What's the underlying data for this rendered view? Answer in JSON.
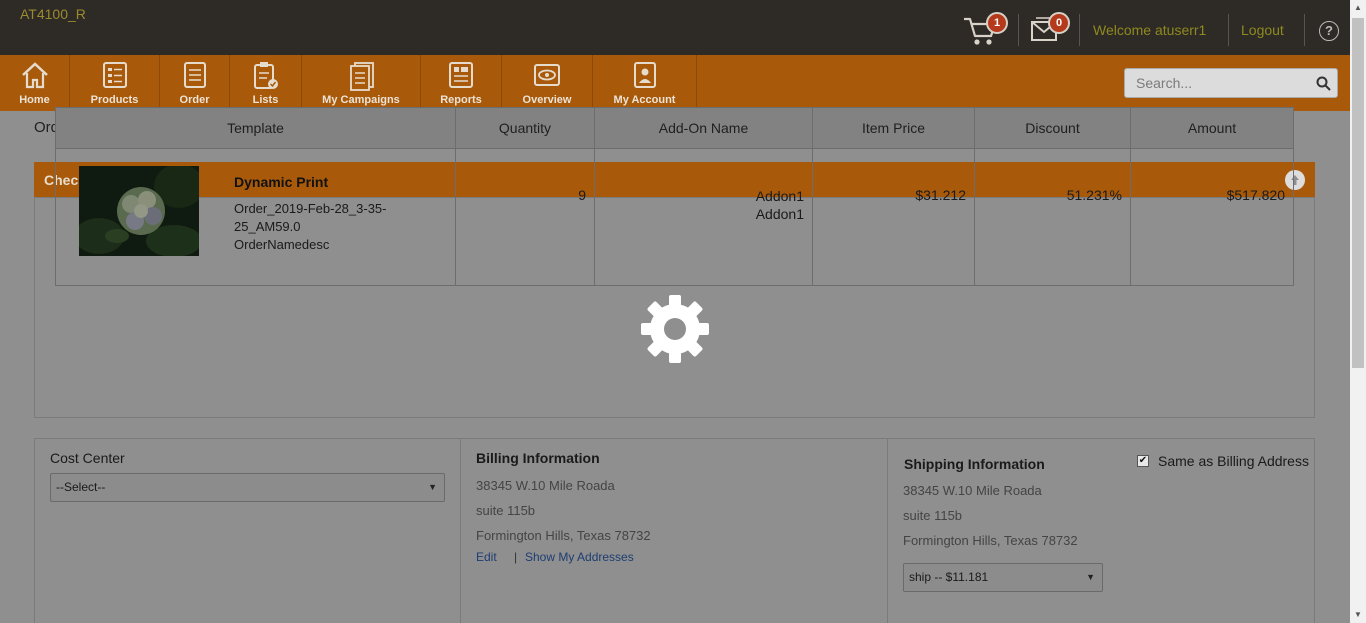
{
  "app": {
    "brand": "AT4100_R",
    "cart_count": "1",
    "messages_count": "0",
    "welcome": "Welcome atuserr1",
    "logout": "Logout",
    "help_icon": "?"
  },
  "nav": {
    "items": [
      {
        "label": "Home",
        "icon": "home-icon"
      },
      {
        "label": "Products",
        "icon": "products-icon"
      },
      {
        "label": "Order",
        "icon": "order-icon"
      },
      {
        "label": "Lists",
        "icon": "lists-icon"
      },
      {
        "label": "My Campaigns",
        "icon": "campaigns-icon"
      },
      {
        "label": "Reports",
        "icon": "reports-icon"
      },
      {
        "label": "Overview",
        "icon": "overview-icon"
      },
      {
        "label": "My Account",
        "icon": "account-icon"
      }
    ],
    "search_placeholder": "Search..."
  },
  "page": {
    "title": "Order Checkout"
  },
  "checkout": {
    "panel_title": "Checkout Item(s)",
    "columns": [
      "Template",
      "Quantity",
      "Add-On Name",
      "Item Price",
      "Discount",
      "Amount"
    ],
    "row": {
      "name": "Dynamic Print",
      "desc_line1": "Order_2019-Feb-28_3-35-",
      "desc_line2": "25_AM59.0",
      "desc_line3": "OrderNamedesc",
      "quantity": "9",
      "addon1": "Addon1",
      "addon2": "Addon1",
      "item_price": "$31.212",
      "discount": "51.231%",
      "amount": "$517.820"
    }
  },
  "cost_center": {
    "title": "Cost Center",
    "selected": "--Select--"
  },
  "billing": {
    "title": "Billing Information",
    "line1": "38345 W.10 Mile Roada",
    "line2": "suite 115b",
    "line3": "Formington Hills, Texas 78732",
    "edit": "Edit",
    "separator": "|",
    "show_addresses": "Show My Addresses"
  },
  "shipping": {
    "title": "Shipping Information",
    "same_as_billing": "Same as Billing Address",
    "same_checked": true,
    "line1": "38345 W.10 Mile Roada",
    "line2": "suite 115b",
    "line3": "Formington Hills, Texas 78732",
    "method": "ship -- $11.181"
  },
  "colors": {
    "topbar": "#2e2a26",
    "nav_orange": "#a85a0a",
    "overlay_gray": "#8f8f8f"
  }
}
